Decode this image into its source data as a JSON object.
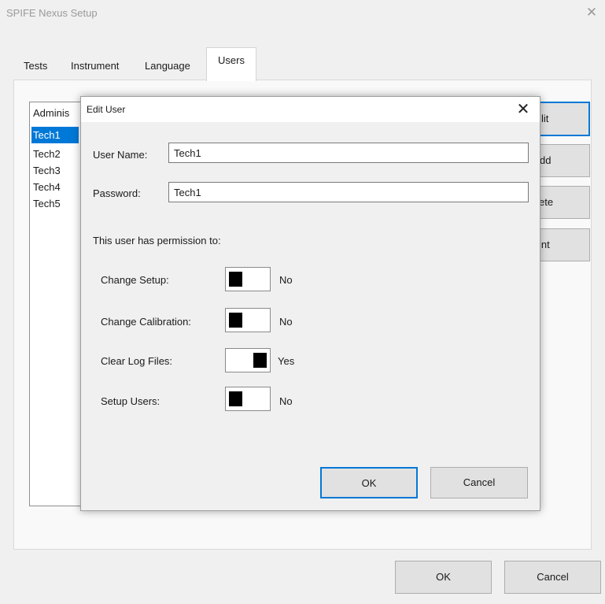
{
  "window": {
    "title": "SPIFE Nexus Setup",
    "close": "✕"
  },
  "tabs": [
    "Tests",
    "Instrument",
    "Language",
    "Users"
  ],
  "user_list": [
    "Adminis",
    "Tech1",
    "Tech2",
    "Tech3",
    "Tech4",
    "Tech5"
  ],
  "selected_user_index": 1,
  "side_buttons": [
    "lit",
    "dd",
    "ete",
    "int"
  ],
  "dialog": {
    "title": "Edit User",
    "close": "✕",
    "user_name_label": "User Name:",
    "user_name_value": "Tech1",
    "password_label": "Password:",
    "password_value": "Tech1",
    "permission_heading": "This user has permission to:",
    "permissions": [
      {
        "label": "Change Setup:",
        "value": "No"
      },
      {
        "label": "Change Calibration:",
        "value": "No"
      },
      {
        "label": "Clear Log Files:",
        "value": "Yes"
      },
      {
        "label": "Setup Users:",
        "value": "No"
      }
    ],
    "ok": "OK",
    "cancel": "Cancel"
  },
  "footer": {
    "ok": "OK",
    "cancel": "Cancel"
  },
  "colors": {
    "selection": "#0078d7",
    "focus_border": "#0078d7"
  }
}
